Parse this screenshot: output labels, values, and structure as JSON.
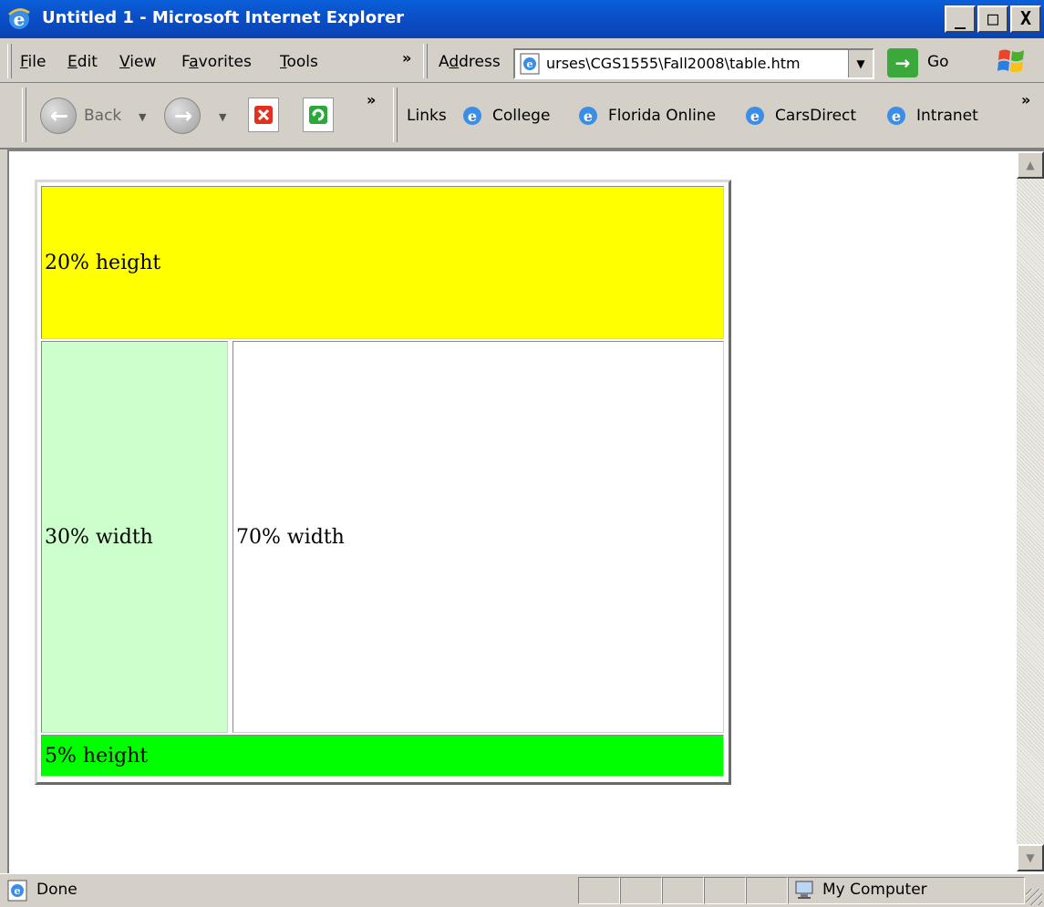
{
  "window": {
    "title": "Untitled 1 - Microsoft Internet Explorer",
    "minimize": "_",
    "maximize": "□",
    "close": "X"
  },
  "menu": {
    "items": [
      {
        "label": "File",
        "accel": "F",
        "rest": "ile"
      },
      {
        "label": "Edit",
        "accel": "E",
        "rest": "dit"
      },
      {
        "label": "View",
        "accel": "V",
        "rest": "iew"
      },
      {
        "label": "Favorites",
        "pre": "F",
        "accel": "a",
        "rest": "vorites"
      },
      {
        "label": "Tools",
        "accel": "T",
        "rest": "ools"
      }
    ],
    "more": "»"
  },
  "address": {
    "label_pre": "A",
    "label_accel": "d",
    "label_rest": "dress",
    "value": "urses\\CGS1555\\Fall2008\\table.htm",
    "go_label": "Go"
  },
  "toolbar": {
    "back_label": "Back",
    "more": "»",
    "links_label": "Links",
    "links": [
      "College",
      "Florida Online",
      "CarsDirect",
      "Intranet"
    ],
    "links_more": "»"
  },
  "page": {
    "cells": {
      "top": "20% height",
      "left": "30% width",
      "right": "70% width",
      "bottom": "5% height"
    },
    "colors": {
      "top": "#ffff00",
      "left": "#ccffcc",
      "right": "#ffffff",
      "bottom": "#00ff00"
    }
  },
  "status": {
    "text": "Done",
    "zone": "My Computer"
  }
}
